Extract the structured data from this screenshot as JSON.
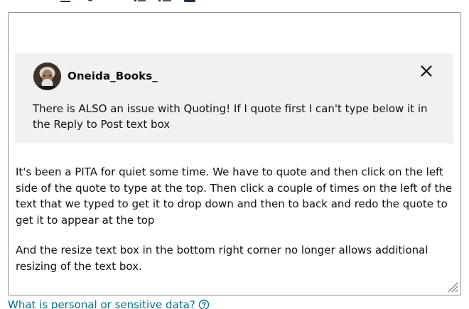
{
  "toolbar": {
    "icons": [
      "underline-icon",
      "link-icon",
      "bulleted-list-icon",
      "numbered-list-icon",
      "image-icon"
    ]
  },
  "quote": {
    "author": "Oneida_Books_",
    "text": "There is ALSO an issue with Quoting! If I quote first I can't type below it in the Reply to Post text box"
  },
  "editor": {
    "paragraphs": [
      "It's been a PITA for quiet some time. We have to quote and then  click on the left side of the quote to type at the top. Then click a couple of times on the left of the text that we typed to get it to drop down and then to back and redo the quote to get it to appear at the top",
      "And the resize text box in the bottom right corner no longer allows additional resizing of the text box."
    ]
  },
  "footer": {
    "link_text": "What is personal or sensitive data?"
  },
  "colors": {
    "link": "#007185",
    "quote_bg": "#f0f2f2",
    "border": "#8d9096"
  }
}
